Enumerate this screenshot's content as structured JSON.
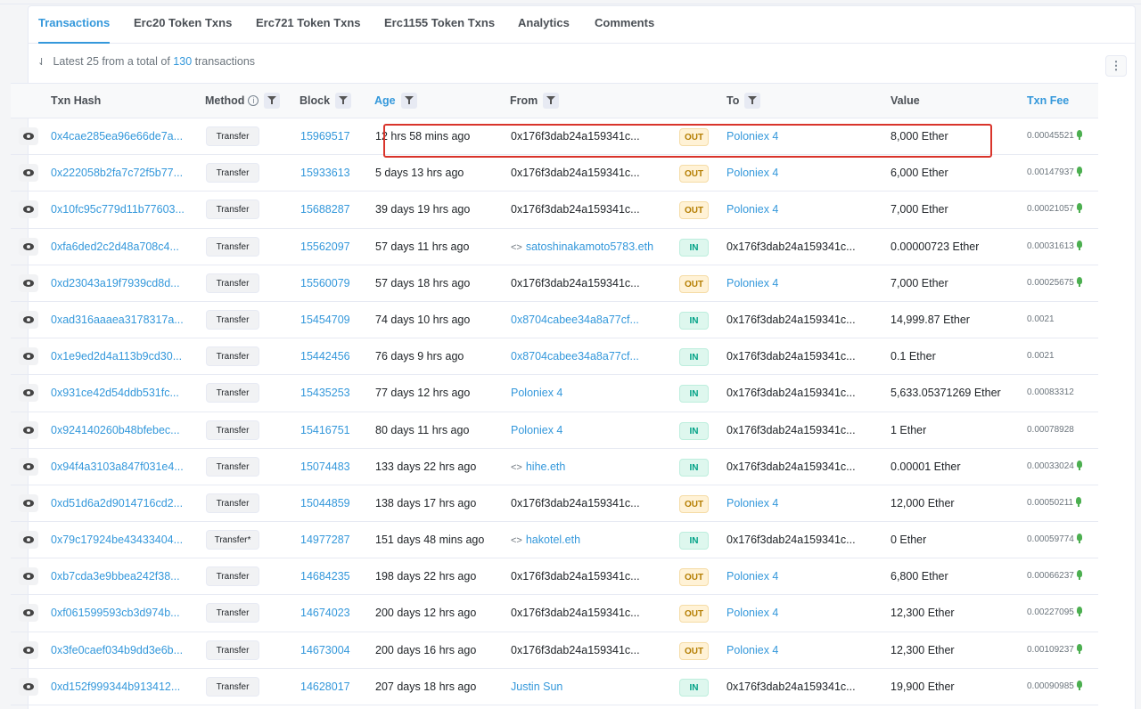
{
  "tabs": [
    {
      "label": "Transactions",
      "active": true
    },
    {
      "label": "Erc20 Token Txns",
      "active": false
    },
    {
      "label": "Erc721 Token Txns",
      "active": false
    },
    {
      "label": "Erc1155 Token Txns",
      "active": false
    },
    {
      "label": "Analytics",
      "active": false
    },
    {
      "label": "Comments",
      "active": false
    }
  ],
  "summary": {
    "prefix": "Latest 25 from a total of",
    "count": "130",
    "suffix": "transactions"
  },
  "more_button": "⋮",
  "columns": {
    "hash": "Txn Hash",
    "method": "Method",
    "block": "Block",
    "age": "Age",
    "from": "From",
    "to": "To",
    "value": "Value",
    "fee": "Txn Fee"
  },
  "rows": [
    {
      "hash": "0x4cae285ea96e66de7a...",
      "method": "Transfer",
      "block": "15969517",
      "age": "12 hrs 58 mins ago",
      "from": "0x176f3dab24a159341c...",
      "from_link": false,
      "from_ens": false,
      "dir": "OUT",
      "to": "Poloniex 4",
      "to_link": true,
      "value": "8,000 Ether",
      "fee": "0.00045521",
      "bulb": true
    },
    {
      "hash": "0x222058b2fa7c72f5b77...",
      "method": "Transfer",
      "block": "15933613",
      "age": "5 days 13 hrs ago",
      "from": "0x176f3dab24a159341c...",
      "from_link": false,
      "from_ens": false,
      "dir": "OUT",
      "to": "Poloniex 4",
      "to_link": true,
      "value": "6,000 Ether",
      "fee": "0.00147937",
      "bulb": true
    },
    {
      "hash": "0x10fc95c779d11b77603...",
      "method": "Transfer",
      "block": "15688287",
      "age": "39 days 19 hrs ago",
      "from": "0x176f3dab24a159341c...",
      "from_link": false,
      "from_ens": false,
      "dir": "OUT",
      "to": "Poloniex 4",
      "to_link": true,
      "value": "7,000 Ether",
      "fee": "0.00021057",
      "bulb": true
    },
    {
      "hash": "0xfa6ded2c2d48a708c4...",
      "method": "Transfer",
      "block": "15562097",
      "age": "57 days 11 hrs ago",
      "from": "satoshinakamoto5783.eth",
      "from_link": true,
      "from_ens": true,
      "dir": "IN",
      "to": "0x176f3dab24a159341c...",
      "to_link": false,
      "value": "0.00000723 Ether",
      "fee": "0.00031613",
      "bulb": true
    },
    {
      "hash": "0xd23043a19f7939cd8d...",
      "method": "Transfer",
      "block": "15560079",
      "age": "57 days 18 hrs ago",
      "from": "0x176f3dab24a159341c...",
      "from_link": false,
      "from_ens": false,
      "dir": "OUT",
      "to": "Poloniex 4",
      "to_link": true,
      "value": "7,000 Ether",
      "fee": "0.00025675",
      "bulb": true
    },
    {
      "hash": "0xad316aaaea3178317a...",
      "method": "Transfer",
      "block": "15454709",
      "age": "74 days 10 hrs ago",
      "from": "0x8704cabee34a8a77cf...",
      "from_link": true,
      "from_ens": false,
      "dir": "IN",
      "to": "0x176f3dab24a159341c...",
      "to_link": false,
      "value": "14,999.87 Ether",
      "fee": "0.0021",
      "bulb": false
    },
    {
      "hash": "0x1e9ed2d4a113b9cd30...",
      "method": "Transfer",
      "block": "15442456",
      "age": "76 days 9 hrs ago",
      "from": "0x8704cabee34a8a77cf...",
      "from_link": true,
      "from_ens": false,
      "dir": "IN",
      "to": "0x176f3dab24a159341c...",
      "to_link": false,
      "value": "0.1 Ether",
      "fee": "0.0021",
      "bulb": false
    },
    {
      "hash": "0x931ce42d54ddb531fc...",
      "method": "Transfer",
      "block": "15435253",
      "age": "77 days 12 hrs ago",
      "from": "Poloniex 4",
      "from_link": true,
      "from_ens": false,
      "dir": "IN",
      "to": "0x176f3dab24a159341c...",
      "to_link": false,
      "value": "5,633.05371269 Ether",
      "fee": "0.00083312",
      "bulb": false
    },
    {
      "hash": "0x924140260b48bfebec...",
      "method": "Transfer",
      "block": "15416751",
      "age": "80 days 11 hrs ago",
      "from": "Poloniex 4",
      "from_link": true,
      "from_ens": false,
      "dir": "IN",
      "to": "0x176f3dab24a159341c...",
      "to_link": false,
      "value": "1 Ether",
      "fee": "0.00078928",
      "bulb": false
    },
    {
      "hash": "0x94f4a3103a847f031e4...",
      "method": "Transfer",
      "block": "15074483",
      "age": "133 days 22 hrs ago",
      "from": "hihe.eth",
      "from_link": true,
      "from_ens": true,
      "dir": "IN",
      "to": "0x176f3dab24a159341c...",
      "to_link": false,
      "value": "0.00001 Ether",
      "fee": "0.00033024",
      "bulb": true
    },
    {
      "hash": "0xd51d6a2d9014716cd2...",
      "method": "Transfer",
      "block": "15044859",
      "age": "138 days 17 hrs ago",
      "from": "0x176f3dab24a159341c...",
      "from_link": false,
      "from_ens": false,
      "dir": "OUT",
      "to": "Poloniex 4",
      "to_link": true,
      "value": "12,000 Ether",
      "fee": "0.00050211",
      "bulb": true
    },
    {
      "hash": "0x79c17924be43433404...",
      "method": "Transfer*",
      "block": "14977287",
      "age": "151 days 48 mins ago",
      "from": "hakotel.eth",
      "from_link": true,
      "from_ens": true,
      "dir": "IN",
      "to": "0x176f3dab24a159341c...",
      "to_link": false,
      "value": "0 Ether",
      "fee": "0.00059774",
      "bulb": true
    },
    {
      "hash": "0xb7cda3e9bbea242f38...",
      "method": "Transfer",
      "block": "14684235",
      "age": "198 days 22 hrs ago",
      "from": "0x176f3dab24a159341c...",
      "from_link": false,
      "from_ens": false,
      "dir": "OUT",
      "to": "Poloniex 4",
      "to_link": true,
      "value": "6,800 Ether",
      "fee": "0.00066237",
      "bulb": true
    },
    {
      "hash": "0xf061599593cb3d974b...",
      "method": "Transfer",
      "block": "14674023",
      "age": "200 days 12 hrs ago",
      "from": "0x176f3dab24a159341c...",
      "from_link": false,
      "from_ens": false,
      "dir": "OUT",
      "to": "Poloniex 4",
      "to_link": true,
      "value": "12,300 Ether",
      "fee": "0.00227095",
      "bulb": true
    },
    {
      "hash": "0x3fe0caef034b9dd3e6b...",
      "method": "Transfer",
      "block": "14673004",
      "age": "200 days 16 hrs ago",
      "from": "0x176f3dab24a159341c...",
      "from_link": false,
      "from_ens": false,
      "dir": "OUT",
      "to": "Poloniex 4",
      "to_link": true,
      "value": "12,300 Ether",
      "fee": "0.00109237",
      "bulb": true
    },
    {
      "hash": "0xd152f999344b913412...",
      "method": "Transfer",
      "block": "14628017",
      "age": "207 days 18 hrs ago",
      "from": "Justin Sun",
      "from_link": true,
      "from_ens": false,
      "dir": "IN",
      "to": "0x176f3dab24a159341c...",
      "to_link": false,
      "value": "19,900 Ether",
      "fee": "0.00090985",
      "bulb": true
    }
  ]
}
